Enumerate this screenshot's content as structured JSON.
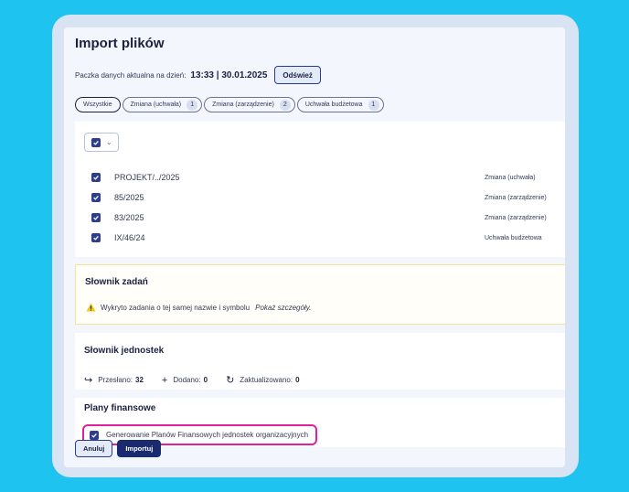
{
  "header": {
    "title": "Import plików",
    "package_label": "Paczka danych aktualna na dzień:",
    "package_date": "13:33 | 30.01.2025",
    "refresh_label": "Odśwież"
  },
  "filters": [
    {
      "label": "Wszystkie",
      "count": null,
      "active": true
    },
    {
      "label": "Zmiana (uchwała)",
      "count": "1",
      "active": false
    },
    {
      "label": "Zmiana (zarządzenie)",
      "count": "2",
      "active": false
    },
    {
      "label": "Uchwała budżetowa",
      "count": "1",
      "active": false
    }
  ],
  "files": [
    {
      "name": "PROJEKT/../2025",
      "type": "Zmiana (uchwała)",
      "checked": true
    },
    {
      "name": "85/2025",
      "type": "Zmiana (zarządzenie)",
      "checked": true
    },
    {
      "name": "83/2025",
      "type": "Zmiana (zarządzenie)",
      "checked": true
    },
    {
      "name": "IX/46/24",
      "type": "Uchwała budżetowa",
      "checked": true
    }
  ],
  "tasks": {
    "title": "Słownik zadań",
    "warning": "Wykryto zadania o tej samej nazwie i symbolu",
    "details_link": "Pokaż szczegóły."
  },
  "units": {
    "title": "Słownik jednostek",
    "sent_label": "Przesłano:",
    "sent_value": "32",
    "added_label": "Dodano:",
    "added_value": "0",
    "updated_label": "Zaktualizowano:",
    "updated_value": "0"
  },
  "plans": {
    "title": "Plany finansowe",
    "generate_label": "Generowanie Planów Finansowych jednostek organizacyjnych",
    "checked": true
  },
  "footer": {
    "cancel_label": "Anuluj",
    "import_label": "Importuj"
  },
  "colors": {
    "background": "#1ec3ef",
    "primary": "#1b2a6e",
    "highlight": "#e0209e",
    "warning": "#f5c518"
  }
}
